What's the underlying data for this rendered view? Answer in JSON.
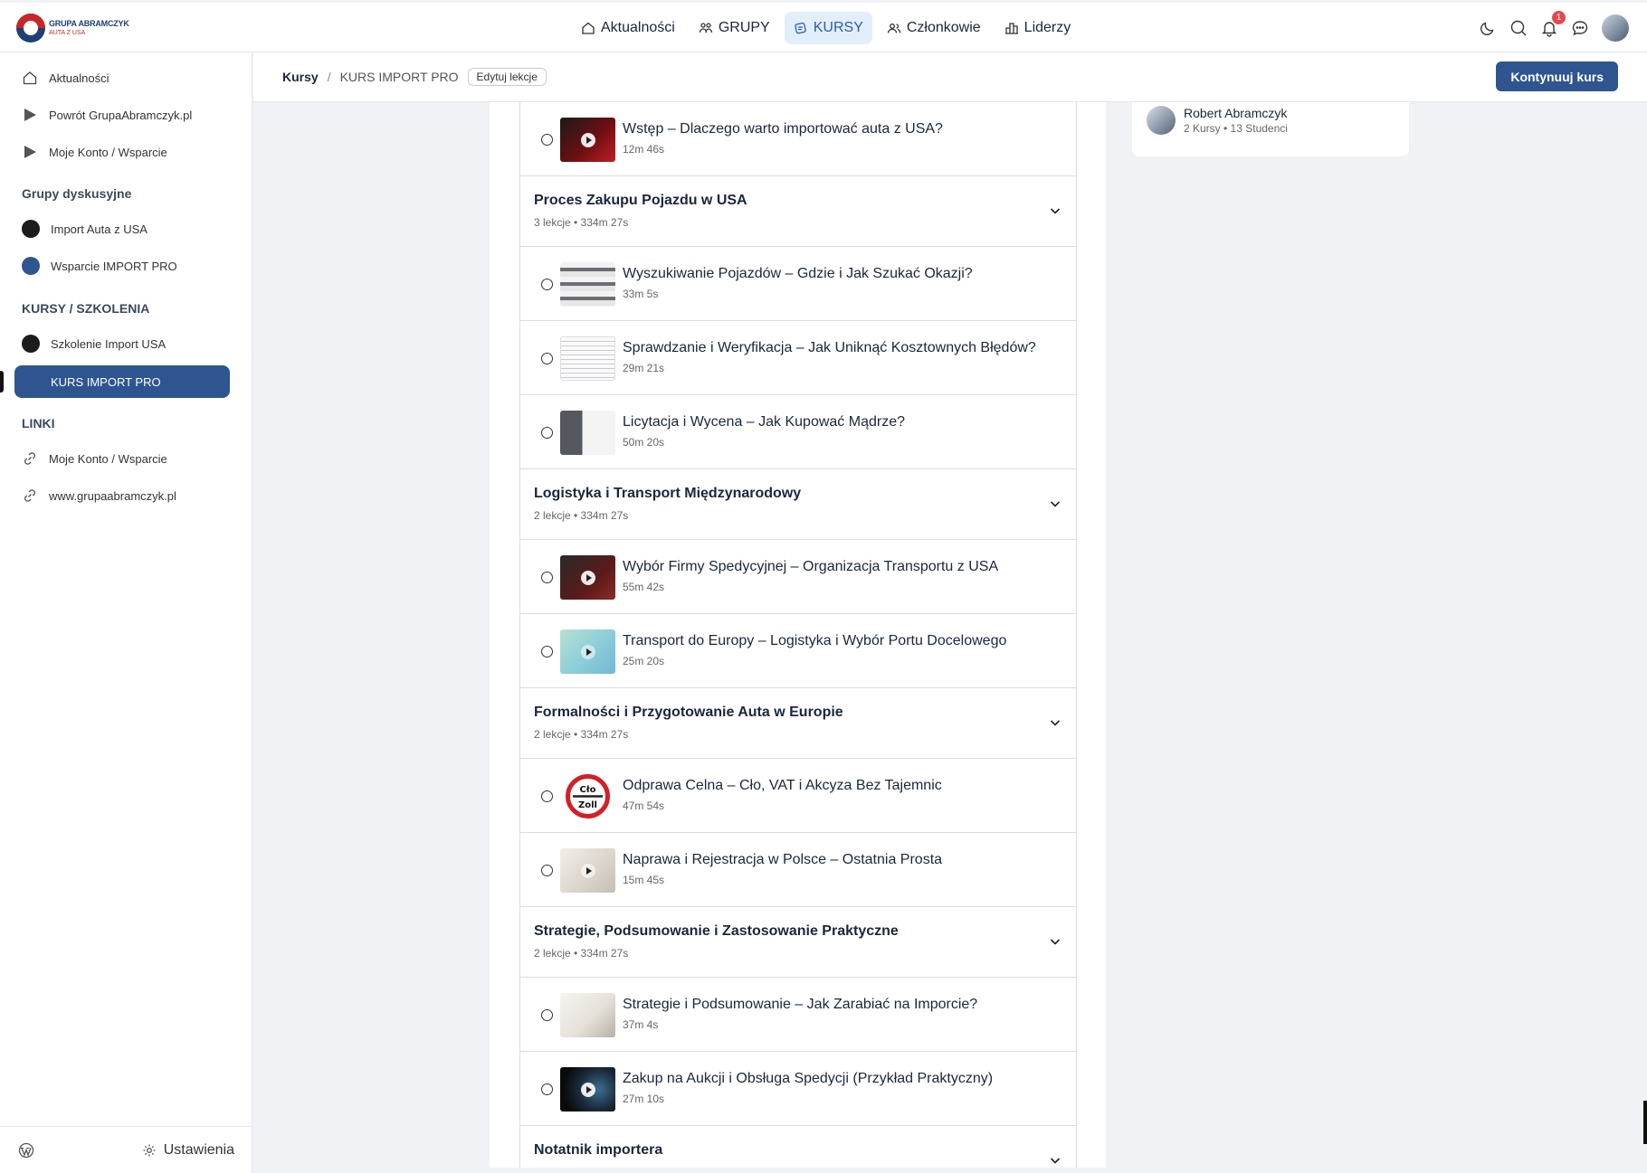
{
  "brand": {
    "line1": "GRUPA ABRAMCZYK",
    "line2": "AUTA Z USA"
  },
  "topnav": [
    {
      "label": "Aktualności",
      "icon": "home-icon",
      "active": false
    },
    {
      "label": "GRUPY",
      "icon": "groups-icon",
      "active": false
    },
    {
      "label": "KURSY",
      "icon": "courses-icon",
      "active": true
    },
    {
      "label": "Członkowie",
      "icon": "members-icon",
      "active": false
    },
    {
      "label": "Liderzy",
      "icon": "leaderboard-icon",
      "active": false
    }
  ],
  "notifications": {
    "count": "1"
  },
  "sidebar": {
    "top_items": [
      {
        "label": "Aktualności",
        "icon": "home-icon"
      },
      {
        "label": "Powrót GrupaAbramczyk.pl",
        "icon": "play-icon"
      },
      {
        "label": "Moje Konto / Wsparcie",
        "icon": "play-icon"
      }
    ],
    "groups_heading": "Grupy dyskusyjne",
    "groups": [
      {
        "label": "Import Auta z USA",
        "color": "#1c1c1c"
      },
      {
        "label": "Wsparcie IMPORT PRO",
        "color": "#2e5590"
      }
    ],
    "courses_heading": "KURSY / SZKOLENIA",
    "courses": [
      {
        "label": "Szkolenie Import USA",
        "color": "#1c1c1c"
      },
      {
        "label": "KURS IMPORT PRO",
        "active": true
      }
    ],
    "links_heading": "LINKI",
    "links": [
      {
        "label": "Moje Konto / Wsparcie",
        "icon": "link-icon"
      },
      {
        "label": "www.grupaabramczyk.pl",
        "icon": "link-icon"
      }
    ],
    "settings_label": "Ustawienia"
  },
  "header": {
    "crumb_root": "Kursy",
    "crumb_separator": "/",
    "crumb_current": "KURS IMPORT PRO",
    "edit_label": "Edytuj lekcje",
    "continue_label": "Kontynuuj kurs"
  },
  "author": {
    "name": "Robert Abramczyk",
    "meta": "2 Kursy • 13 Studenci"
  },
  "lessons": {
    "l0": {
      "title": "Wstęp – Dlaczego warto importować auta z USA?",
      "duration": "12m 46s"
    },
    "s1": {
      "title": "Proces Zakupu Pojazdu w USA",
      "meta": "3 lekcje • 334m 27s"
    },
    "l1": {
      "title": "Wyszukiwanie Pojazdów – Gdzie i Jak Szukać Okazji?",
      "duration": "33m 5s"
    },
    "l2": {
      "title": "Sprawdzanie i Weryfikacja – Jak Uniknąć Kosztownych Błędów?",
      "duration": "29m 21s"
    },
    "l3": {
      "title": "Licytacja i Wycena – Jak Kupować Mądrze?",
      "duration": "50m 20s"
    },
    "s2": {
      "title": "Logistyka i Transport Międzynarodowy",
      "meta": "2 lekcje • 334m 27s"
    },
    "l4": {
      "title": "Wybór Firmy Spedycyjnej – Organizacja Transportu z USA",
      "duration": "55m 42s"
    },
    "l5": {
      "title": "Transport do Europy – Logistyka i Wybór Portu Docelowego",
      "duration": "25m 20s"
    },
    "s3": {
      "title": "Formalności i Przygotowanie Auta w Europie",
      "meta": "2 lekcje • 334m 27s"
    },
    "l6": {
      "title": "Odprawa Celna – Cło, VAT i Akcyza Bez Tajemnic",
      "duration": "47m 54s",
      "thumb_text": "Cło Zoll"
    },
    "l7": {
      "title": "Naprawa i Rejestracja w Polsce – Ostatnia Prosta",
      "duration": "15m 45s"
    },
    "s4": {
      "title": "Strategie, Podsumowanie i Zastosowanie Praktyczne",
      "meta": "2 lekcje • 334m 27s"
    },
    "l8": {
      "title": "Strategie i Podsumowanie – Jak Zarabiać na Imporcie?",
      "duration": "37m 4s"
    },
    "l9": {
      "title": "Zakup na Aukcji i Obsługa Spedycji (Przykład Praktyczny)",
      "duration": "27m 10s"
    },
    "s5": {
      "title": "Notatnik importera"
    }
  }
}
